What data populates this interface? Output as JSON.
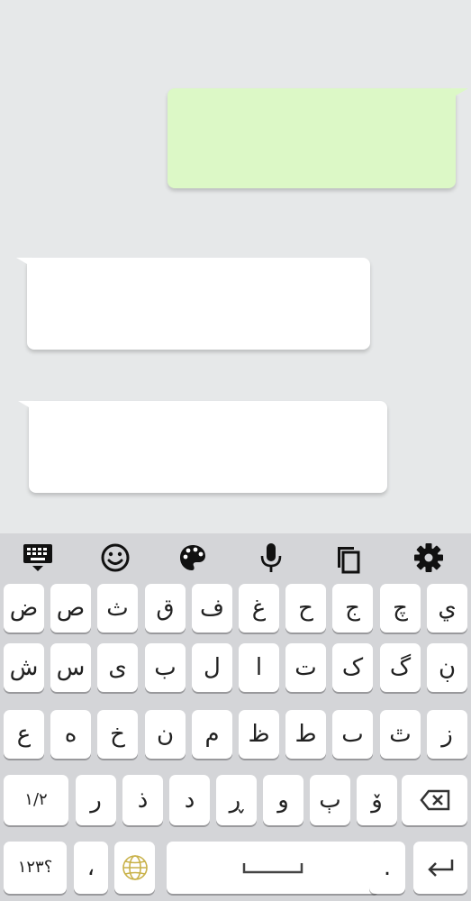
{
  "keyboard": {
    "toolbar": [
      {
        "name": "keyboard-hide-icon"
      },
      {
        "name": "emoji-icon"
      },
      {
        "name": "palette-icon"
      },
      {
        "name": "microphone-icon"
      },
      {
        "name": "clipboard-icon"
      },
      {
        "name": "settings-gear-icon"
      }
    ],
    "rows": [
      [
        "ض",
        "ص",
        "ث",
        "ق",
        "ف",
        "غ",
        "ح",
        "ج",
        "چ",
        "ي"
      ],
      [
        "ش",
        "س",
        "ی",
        "ب",
        "ل",
        "ا",
        "ت",
        "ک",
        "گ",
        "ڹ"
      ],
      [
        "ع",
        "ه",
        "خ",
        "ن",
        "م",
        "ظ",
        "ط",
        "ٮ",
        "ٿ",
        "ز"
      ],
      [
        "ر",
        "ذ",
        "د",
        "ڕ",
        "و",
        "ٻ",
        "ۆ"
      ]
    ],
    "shift_label": "۱/۲",
    "numbers_label": "؟۱۲۳",
    "comma_label": "،",
    "period_label": ".",
    "colors": {
      "outgoing_bubble": "#dcf8c6",
      "incoming_bubble": "#ffffff",
      "keyboard_bg": "#d4d5d8",
      "key_bg": "#ffffff"
    }
  }
}
